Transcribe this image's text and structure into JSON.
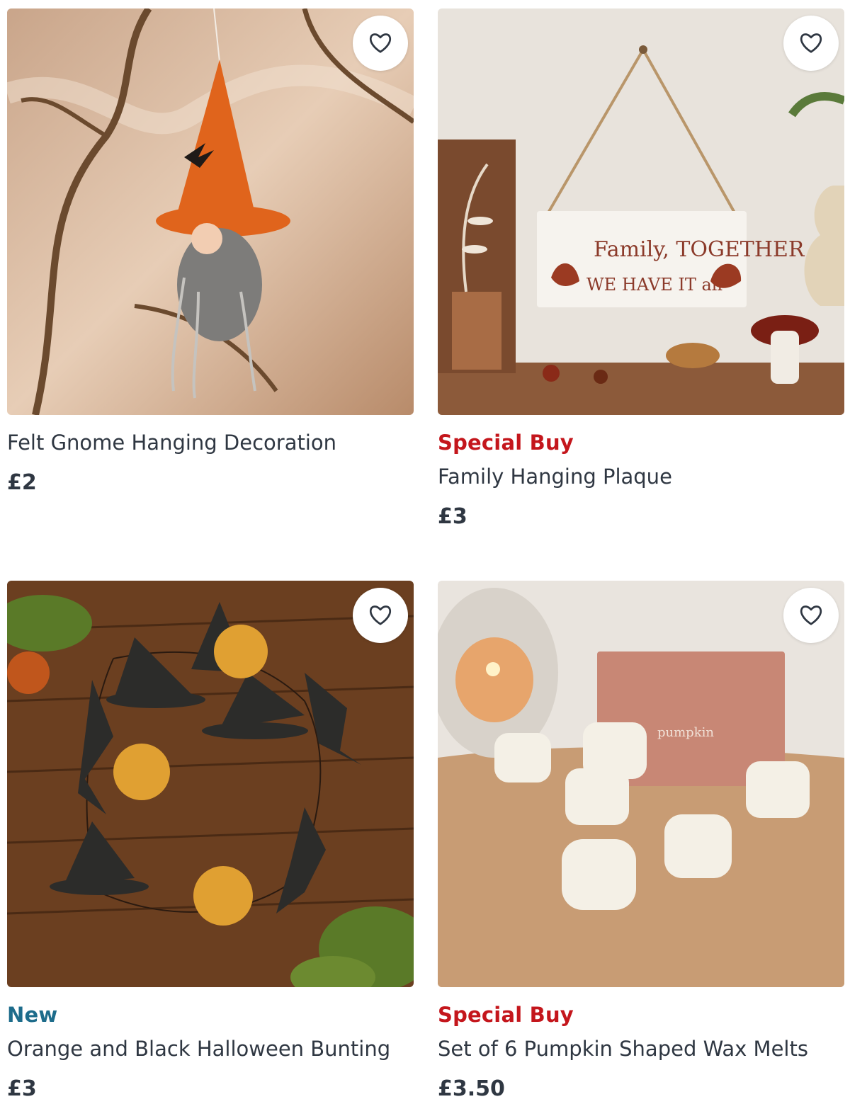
{
  "products": [
    {
      "name": "Felt Gnome Hanging Decoration",
      "badge": "",
      "price": "£2",
      "image_alt": "felt-gnome-image"
    },
    {
      "name": "Family Hanging Plaque",
      "badge": "Special Buy",
      "price": "£3",
      "image_alt": "family-plaque-image",
      "plaque_text": {
        "line1": "Family, TOGETHER",
        "line2": "WE HAVE IT all"
      }
    },
    {
      "name": "Orange and Black Halloween Bunting",
      "badge": "New",
      "price": "£3",
      "image_alt": "halloween-bunting-image"
    },
    {
      "name": "Set of 6 Pumpkin Shaped Wax Melts",
      "badge": "Special Buy",
      "price": "£3.50",
      "image_alt": "wax-melts-image",
      "box_text": "pumpkin"
    }
  ],
  "icons": {
    "favourite": "heart-outline-icon"
  },
  "colors": {
    "special_buy": "#c4161c",
    "new": "#1d6c8b",
    "text": "#2f3742"
  }
}
